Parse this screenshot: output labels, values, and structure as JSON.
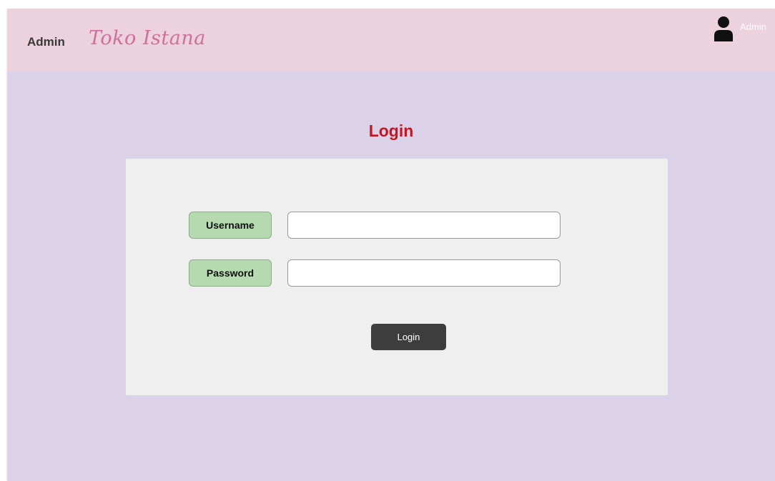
{
  "navbar": {
    "admin_label": "Admin",
    "brand": "Toko Istana",
    "user_label": "Admin",
    "user_icon": "user-icon"
  },
  "page": {
    "title": "Login"
  },
  "form": {
    "username_label": "Username",
    "username_value": "",
    "password_label": "Password",
    "password_value": "",
    "submit_label": "Login"
  },
  "colors": {
    "page_background": "#dbd2e9",
    "navbar_background": "#ebd2dc",
    "brand_text": "#cf6f9b",
    "title_text": "#c8141e",
    "panel_background": "#efefef",
    "label_background": "#b6dab0",
    "button_background": "#3d3d3d"
  }
}
